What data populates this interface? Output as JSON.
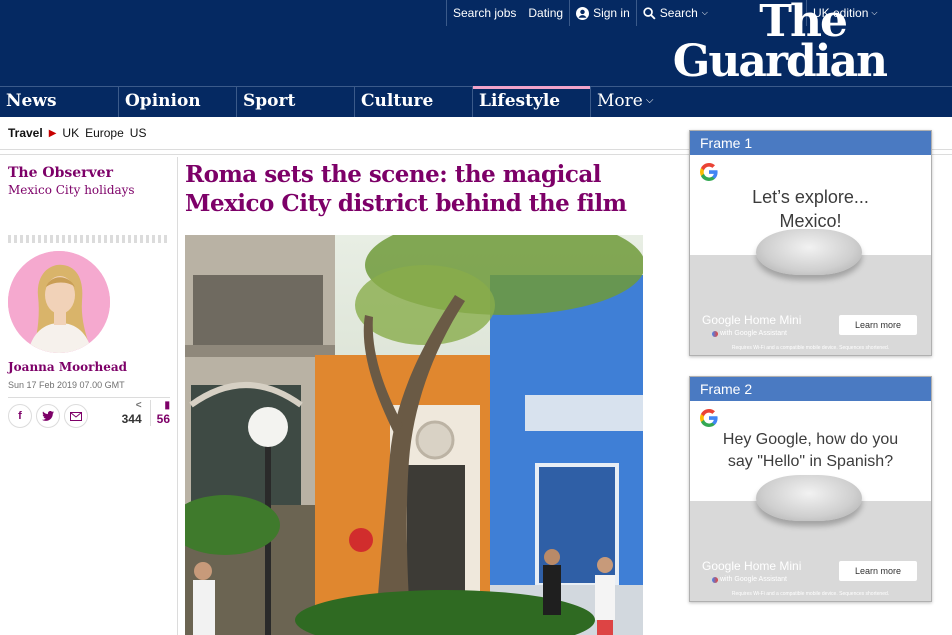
{
  "header": {
    "links": [
      "Search jobs",
      "Dating"
    ],
    "sign_in": "Sign in",
    "search": "Search",
    "edition": "UK edition",
    "logo_line1": "The",
    "logo_line2": "Guardian"
  },
  "nav": {
    "items": [
      {
        "label": "News",
        "color": "#c70000"
      },
      {
        "label": "Opinion",
        "color": "#e05e00"
      },
      {
        "label": "Sport",
        "color": "#0084c6"
      },
      {
        "label": "Culture",
        "color": "#a1845c"
      },
      {
        "label": "Lifestyle",
        "color": "#bb3b80"
      }
    ],
    "more": "More"
  },
  "subnav": {
    "section": "Travel",
    "links": [
      "UK",
      "Europe",
      "US"
    ]
  },
  "article": {
    "series_title": "The Observer",
    "series_sub": "Mexico City holidays",
    "headline": "Roma sets the scene: the magical Mexico City district behind the film",
    "author": "Joanna Moorhead",
    "date": "Sun 17 Feb 2019 07.00 GMT",
    "share_count": "344",
    "comment_count": "56"
  },
  "ads": [
    {
      "frame_title": "Frame 1",
      "text_line1": "Let’s explore...",
      "text_line2": "Mexico!",
      "product": "Google Home Mini",
      "assistant": "with Google Assistant",
      "cta": "Learn more",
      "fineprint": "Requires Wi-Fi and a compatible mobile device. Sequences shortened."
    },
    {
      "frame_title": "Frame 2",
      "text_line1": "Hey Google, how do you",
      "text_line2": "say \"Hello\" in Spanish?",
      "product": "Google Home Mini",
      "assistant": "with Google Assistant",
      "cta": "Learn more",
      "fineprint": "Requires Wi-Fi and a compatible mobile device. Sequences shortened."
    }
  ],
  "colors": {
    "brand": "#052962",
    "pillar": "#7d0068",
    "ad_header": "#4a7ac2"
  }
}
